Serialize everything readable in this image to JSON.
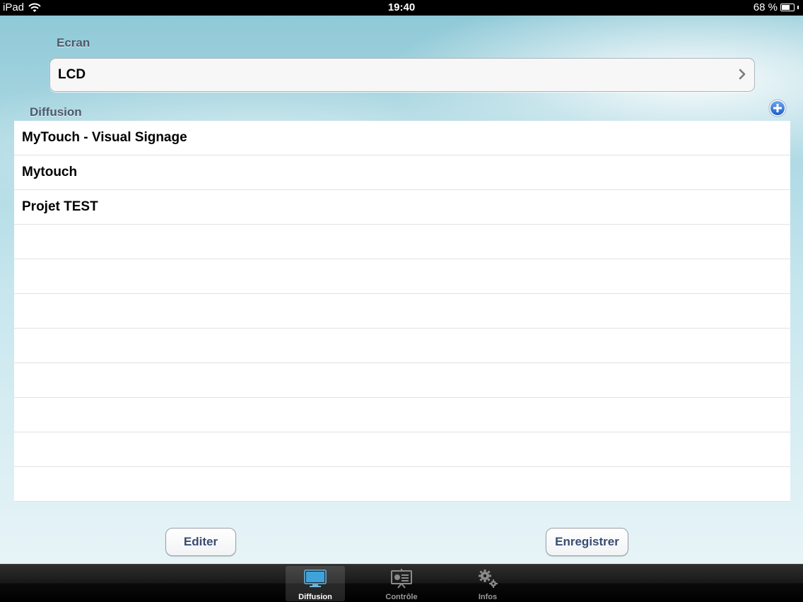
{
  "status_bar": {
    "carrier": "iPad",
    "time": "19:40",
    "battery": "68 %",
    "battery_level": 0.68
  },
  "screen_section": {
    "header": "Ecran",
    "selected_value": "LCD"
  },
  "diffusion_section": {
    "header": "Diffusion",
    "items": [
      {
        "label": "MyTouch - Visual Signage"
      },
      {
        "label": "Mytouch"
      },
      {
        "label": "Projet TEST"
      }
    ],
    "empty_rows": 8
  },
  "buttons": {
    "edit_label": "Editer",
    "save_label": "Enregistrer"
  },
  "tab_bar": {
    "tabs": [
      {
        "label": "Diffusion",
        "icon": "monitor-icon",
        "selected": true
      },
      {
        "label": "Contrôle",
        "icon": "presentation-board-icon",
        "selected": false
      },
      {
        "label": "Infos",
        "icon": "gears-icon",
        "selected": false
      }
    ]
  },
  "colors": {
    "accent_blue": "#2f6fd0",
    "button_text": "#384c73",
    "section_header": "#4d5a6b"
  }
}
